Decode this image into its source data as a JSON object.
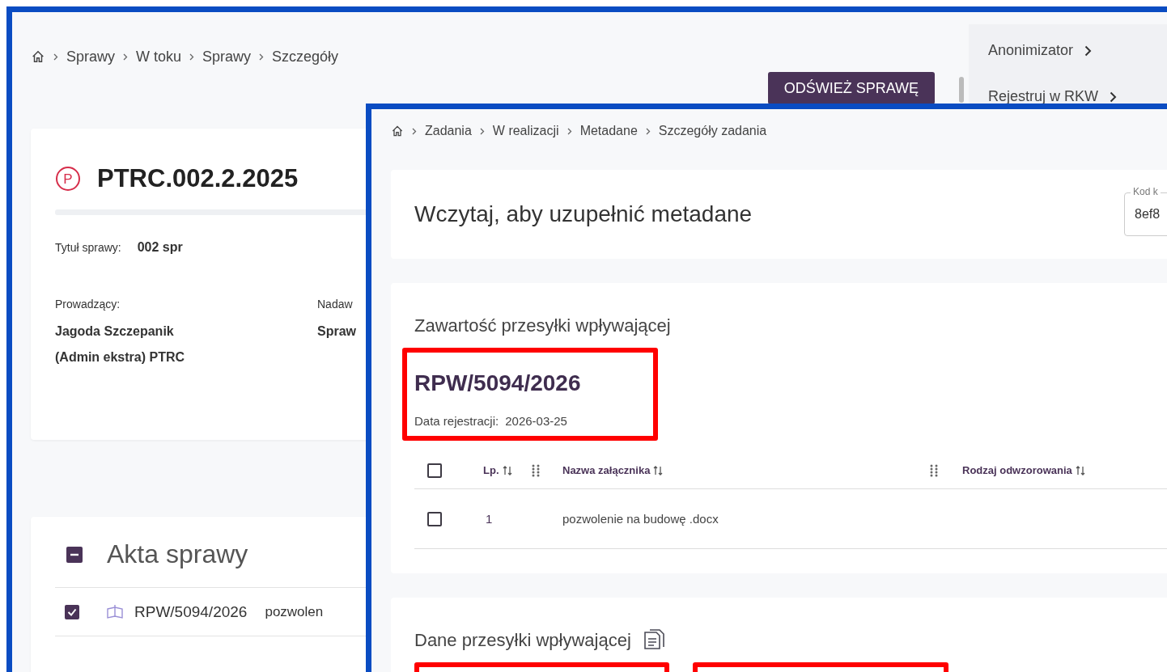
{
  "back_window": {
    "breadcrumbs": [
      "Sprawy",
      "W toku",
      "Sprawy",
      "Szczegóły"
    ],
    "refresh_button": "ODŚWIEŻ SPRAWĘ",
    "side_menu": [
      {
        "label": "Anonimizator"
      },
      {
        "label": "Rejestruj w RKW"
      }
    ],
    "case": {
      "badge": "P",
      "number": "PTRC.002.2.2025",
      "title_label": "Tytuł sprawy:",
      "title_value": "002 spr",
      "fields": [
        {
          "label": "Prowadzący:",
          "value": "Jagoda Szczepanik\n(Admin ekstra) PTRC"
        },
        {
          "label": "Nadaw",
          "value": "Spraw"
        }
      ]
    },
    "files": {
      "title": "Akta sprawy",
      "expanded": true,
      "rows": [
        {
          "checked": true,
          "number": "RPW/5094/2026",
          "name": "pozwolen"
        }
      ]
    }
  },
  "front_window": {
    "breadcrumbs": [
      "Zadania",
      "W realizacji",
      "Metadane",
      "Szczegóły zadania"
    ],
    "heading": "Wczytaj, aby uzupełnić metadane",
    "code_field": {
      "label": "Kod k",
      "value": "8ef8"
    },
    "contents": {
      "title": "Zawartość przesyłki wpływającej",
      "number": "RPW/5094/2026",
      "date_label": "Data rejestracji:",
      "date": "2026-03-25",
      "all_checked": false,
      "columns": [
        "Lp.",
        "Nazwa załącznika",
        "Rodzaj odwzorowania"
      ],
      "rows": [
        {
          "checked": false,
          "lp": "1",
          "name": "pozwolenie na budowę .docx"
        }
      ]
    },
    "details": {
      "title": "Dane przesyłki wpływającej"
    }
  }
}
